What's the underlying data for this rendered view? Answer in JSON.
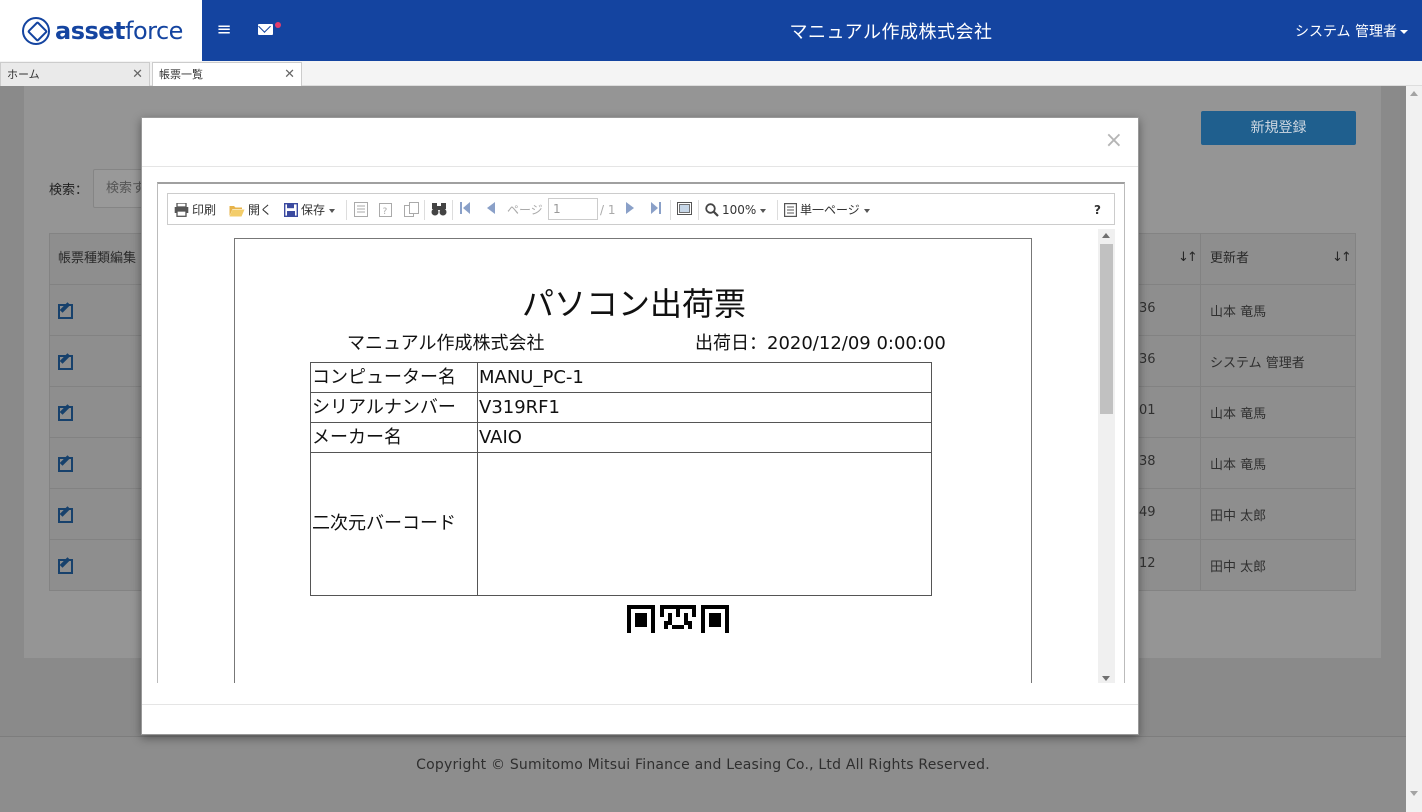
{
  "header": {
    "logo_text_bold": "asset",
    "logo_text_light": "force",
    "company": "マニュアル作成株式会社",
    "user": "システム 管理者"
  },
  "tabs": [
    {
      "label": "ホーム"
    },
    {
      "label": "帳票一覧"
    }
  ],
  "page": {
    "new_button": "新規登録",
    "search_label": "検索：",
    "search_placeholder": "検索す",
    "columns": {
      "form_type": "帳票種類編集",
      "updater": "更新者"
    },
    "rows": [
      {
        "time": "36",
        "user": "山本 竜馬"
      },
      {
        "time": "36",
        "user": "システム 管理者"
      },
      {
        "time": "01",
        "user": "山本 竜馬"
      },
      {
        "time": "38",
        "user": "山本 竜馬"
      },
      {
        "time": "49",
        "user": "田中 太郎"
      },
      {
        "time": "12",
        "user": "田中 太郎"
      }
    ],
    "footer": "Copyright © Sumitomo Mitsui Finance and Leasing Co., Ltd All Rights Reserved."
  },
  "modal": {
    "close": "×",
    "toolbar": {
      "print": "印刷",
      "open": "開く",
      "save": "保存",
      "page_label": "ページ",
      "page_value": "1",
      "page_total": "/ 1",
      "zoom": "100%",
      "view_mode": "単一ページ",
      "help": "?"
    },
    "document": {
      "title": "パソコン出荷票",
      "company": "マニュアル作成株式会社",
      "ship_date": "出荷日：2020/12/09 0:00:00",
      "fields": [
        {
          "key": "コンピューター名",
          "value": "MANU_PC-1"
        },
        {
          "key": "シリアルナンバー",
          "value": "V319RF1"
        },
        {
          "key": "メーカー名",
          "value": "VAIO"
        },
        {
          "key": "二次元バーコード",
          "value": ""
        }
      ]
    }
  },
  "colors": {
    "header_bg": "#1444a0",
    "button_bg": "#1f5f8e",
    "edit_icon": "#17416c",
    "mail_dot": "#e33d6c"
  }
}
